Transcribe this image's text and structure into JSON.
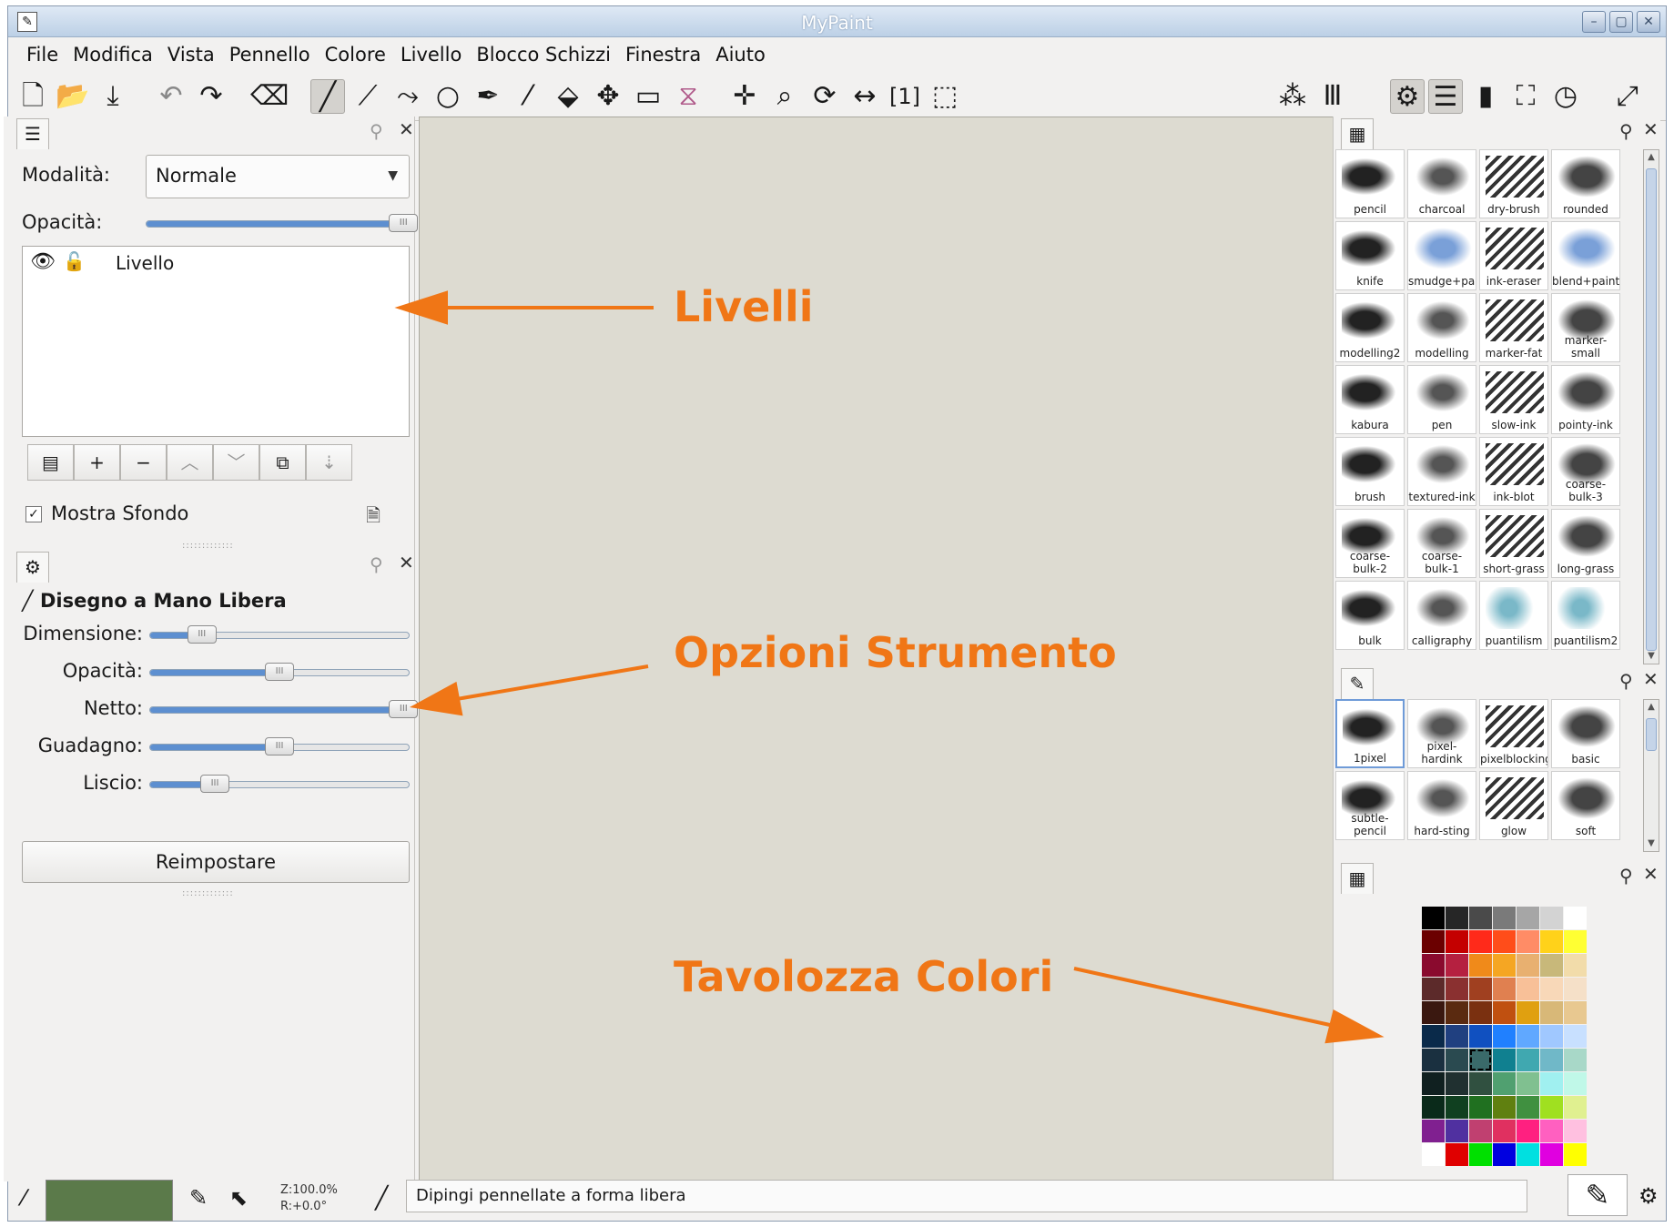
{
  "window": {
    "title": "MyPaint"
  },
  "menu": [
    "File",
    "Modifica",
    "Vista",
    "Pennello",
    "Colore",
    "Livello",
    "Blocco Schizzi",
    "Finestra",
    "Aiuto"
  ],
  "layers_panel": {
    "mode_label": "Modalità:",
    "mode_value": "Normale",
    "opacity_label": "Opacità:",
    "opacity_level": 0.98,
    "layer_name": "Livello",
    "show_background_label": "Mostra Sfondo",
    "show_background_checked": true
  },
  "tool_options": {
    "title": "Disegno a Mano Libera",
    "sliders": [
      {
        "label": "Dimensione:",
        "value": 0.2
      },
      {
        "label": "Opacità:",
        "value": 0.5
      },
      {
        "label": "Netto:",
        "value": 0.98
      },
      {
        "label": "Guadagno:",
        "value": 0.5
      },
      {
        "label": "Liscio:",
        "value": 0.25
      }
    ],
    "reset_label": "Reimpostare"
  },
  "brushes_top": [
    "pencil",
    "charcoal",
    "dry-brush",
    "rounded",
    "knife",
    "smudge+paint",
    "ink-eraser",
    "blend+paint",
    "modelling2",
    "modelling",
    "marker-fat",
    "marker-small",
    "kabura",
    "pen",
    "slow-ink",
    "pointy-ink",
    "brush",
    "textured-ink",
    "ink-blot",
    "coarse-bulk-3",
    "coarse-bulk-2",
    "coarse-bulk-1",
    "short-grass",
    "long-grass",
    "bulk",
    "calligraphy",
    "puantilism",
    "puantilism2"
  ],
  "brushes_bottom": [
    "1pixel",
    "pixel-hardink",
    "pixelblocking",
    "basic",
    "subtle-pencil",
    "hard-sting",
    "glow",
    "soft"
  ],
  "selected_brush": "1pixel",
  "palette": {
    "colors": [
      "#000000",
      "#262626",
      "#4a4a4a",
      "#7a7a7a",
      "#a6a6a6",
      "#d3d3d3",
      "#ffffff",
      "#6b0000",
      "#c40000",
      "#ff2a1a",
      "#ff4d1a",
      "#ff8c66",
      "#ffd21a",
      "#ffff33",
      "#8a0a2e",
      "#b52040",
      "#f08a1a",
      "#f5a623",
      "#e8b070",
      "#c8b87a",
      "#f2dcaa",
      "#5c2a2a",
      "#8a3030",
      "#a04020",
      "#e08050",
      "#f8c098",
      "#f8d8b8",
      "#f5e0c8",
      "#3a1810",
      "#5a2a10",
      "#7a3010",
      "#c05010",
      "#e0a010",
      "#d8b878",
      "#e8c890",
      "#0a2a4a",
      "#204080",
      "#1050c0",
      "#2080ff",
      "#60a8ff",
      "#a0c8ff",
      "#c8e0ff",
      "#1a3040",
      "#2a4a50",
      "#3a6a6a",
      "#108090",
      "#40a8b0",
      "#70b8c8",
      "#a8d8c8",
      "#102020",
      "#203030",
      "#305040",
      "#50a070",
      "#80c090",
      "#a0f0f0",
      "#c0f8e8",
      "#0a2a1a",
      "#104020",
      "#207020",
      "#608010",
      "#409040",
      "#a0e020",
      "#e0f090",
      "#802090",
      "#5030a0",
      "#c04070",
      "#e03060",
      "#ff2080",
      "#ff60c0",
      "#ffc0e0",
      "#ffffff",
      "#e00000",
      "#00e000",
      "#0000e0",
      "#00e0e0",
      "#e000e0",
      "#ffff00"
    ],
    "selected_index": 44
  },
  "status": {
    "zoom": "Z:100.0%",
    "rotation": "R:+0.0°",
    "message": "Dipingi pennellate a forma libera",
    "color": "#5b7a4a"
  },
  "annotations": {
    "layers": "Livelli",
    "tool_options": "Opzioni Strumento",
    "palette": "Tavolozza Colori"
  },
  "colors": {
    "accent_annotation": "#f07616",
    "canvas": "#dddbd1",
    "slider_fill": "#5d8fd0"
  }
}
